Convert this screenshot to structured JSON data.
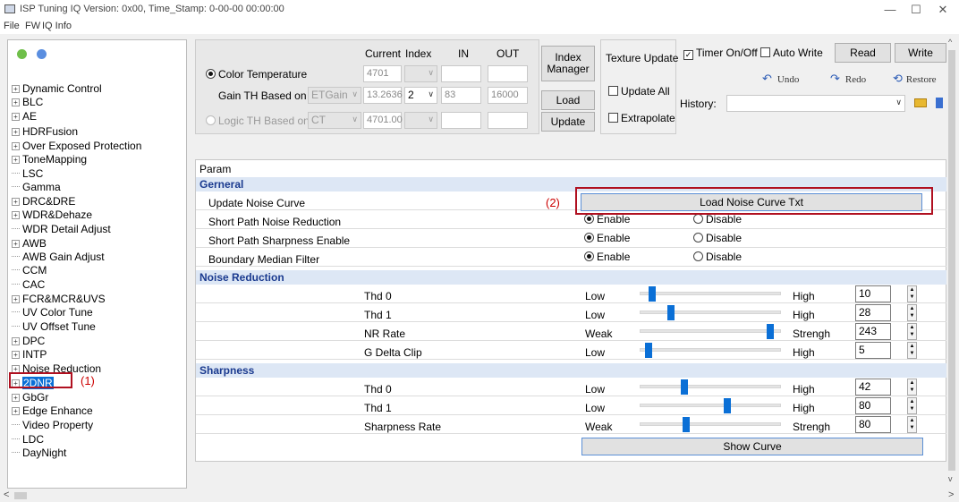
{
  "window": {
    "title": "ISP Tuning IQ Version: 0x00, Time_Stamp: 0-00-00 00:00:00",
    "minimize": "—",
    "maximize": "☐",
    "close": "✕"
  },
  "menu": [
    "File",
    "FW",
    "IQ Info"
  ],
  "tree": {
    "items": [
      "Dynamic Control",
      "BLC",
      "AE",
      "HDRFusion",
      "Over Exposed Protection",
      "ToneMapping",
      "LSC",
      "Gamma",
      "DRC&DRE",
      "WDR&Dehaze",
      "WDR Detail Adjust",
      "AWB",
      "AWB Gain Adjust",
      "CCM",
      "CAC",
      "FCR&MCR&UVS",
      "UV Color Tune",
      "UV Offset Tune",
      "DPC",
      "INTP",
      "Noise Reduction",
      "2DNR",
      "GbGr",
      "Edge Enhance",
      "Video Property",
      "LDC",
      "DayNight"
    ],
    "selected": "2DNR",
    "annotation": "(1)"
  },
  "top": {
    "headers": {
      "current": "Current",
      "index": "Index",
      "in": "IN",
      "out": "OUT"
    },
    "color_temp": {
      "label": "Color Temperature",
      "current": "4701"
    },
    "gain_th": {
      "label": "Gain TH Based on",
      "select": "ETGain",
      "current": "13.2636",
      "index": "2",
      "in": "83",
      "out": "16000"
    },
    "logic_th": {
      "label": "Logic TH Based on",
      "select": "CT",
      "current": "4701.00"
    },
    "buttons": {
      "index_manager": "Index Manager",
      "load": "Load",
      "update": "Update"
    },
    "texture": {
      "title": "Texture Update",
      "update_all": "Update All",
      "extrapolate": "Extrapolate"
    },
    "timer": "Timer On/Off",
    "auto_write": "Auto Write",
    "read": "Read",
    "write": "Write",
    "undo": "Undo",
    "redo": "Redo",
    "restore": "Restore",
    "history": "History:"
  },
  "param": {
    "header": "Param",
    "general": {
      "title": "Gerneral",
      "update_noise_curve": "Update Noise Curve",
      "annotation": "(2)",
      "load_btn": "Load Noise Curve Txt",
      "rows": [
        {
          "label": "Short Path Noise Reduction"
        },
        {
          "label": "Short Path Sharpness Enable"
        },
        {
          "label": "Boundary Median Filter"
        }
      ],
      "enable": "Enable",
      "disable": "Disable"
    },
    "noise_reduction": {
      "title": "Noise Reduction",
      "rows": [
        {
          "label": "Thd 0",
          "low": "Low",
          "high": "High",
          "value": "10",
          "frac": 0.06
        },
        {
          "label": "Thd 1",
          "low": "Low",
          "high": "High",
          "value": "28",
          "frac": 0.2
        },
        {
          "label": "NR Rate",
          "low": "Weak",
          "high": "Strengh",
          "value": "243",
          "frac": 0.94
        },
        {
          "label": "G Delta Clip",
          "low": "Low",
          "high": "High",
          "value": "5",
          "frac": 0.03
        }
      ]
    },
    "sharpness": {
      "title": "Sharpness",
      "rows": [
        {
          "label": "Thd 0",
          "low": "Low",
          "high": "High",
          "value": "42",
          "frac": 0.3
        },
        {
          "label": "Thd 1",
          "low": "Low",
          "high": "High",
          "value": "80",
          "frac": 0.62
        },
        {
          "label": "Sharpness Rate",
          "low": "Weak",
          "high": "Strengh",
          "value": "80",
          "frac": 0.31
        }
      ]
    },
    "show_curve": "Show Curve"
  }
}
